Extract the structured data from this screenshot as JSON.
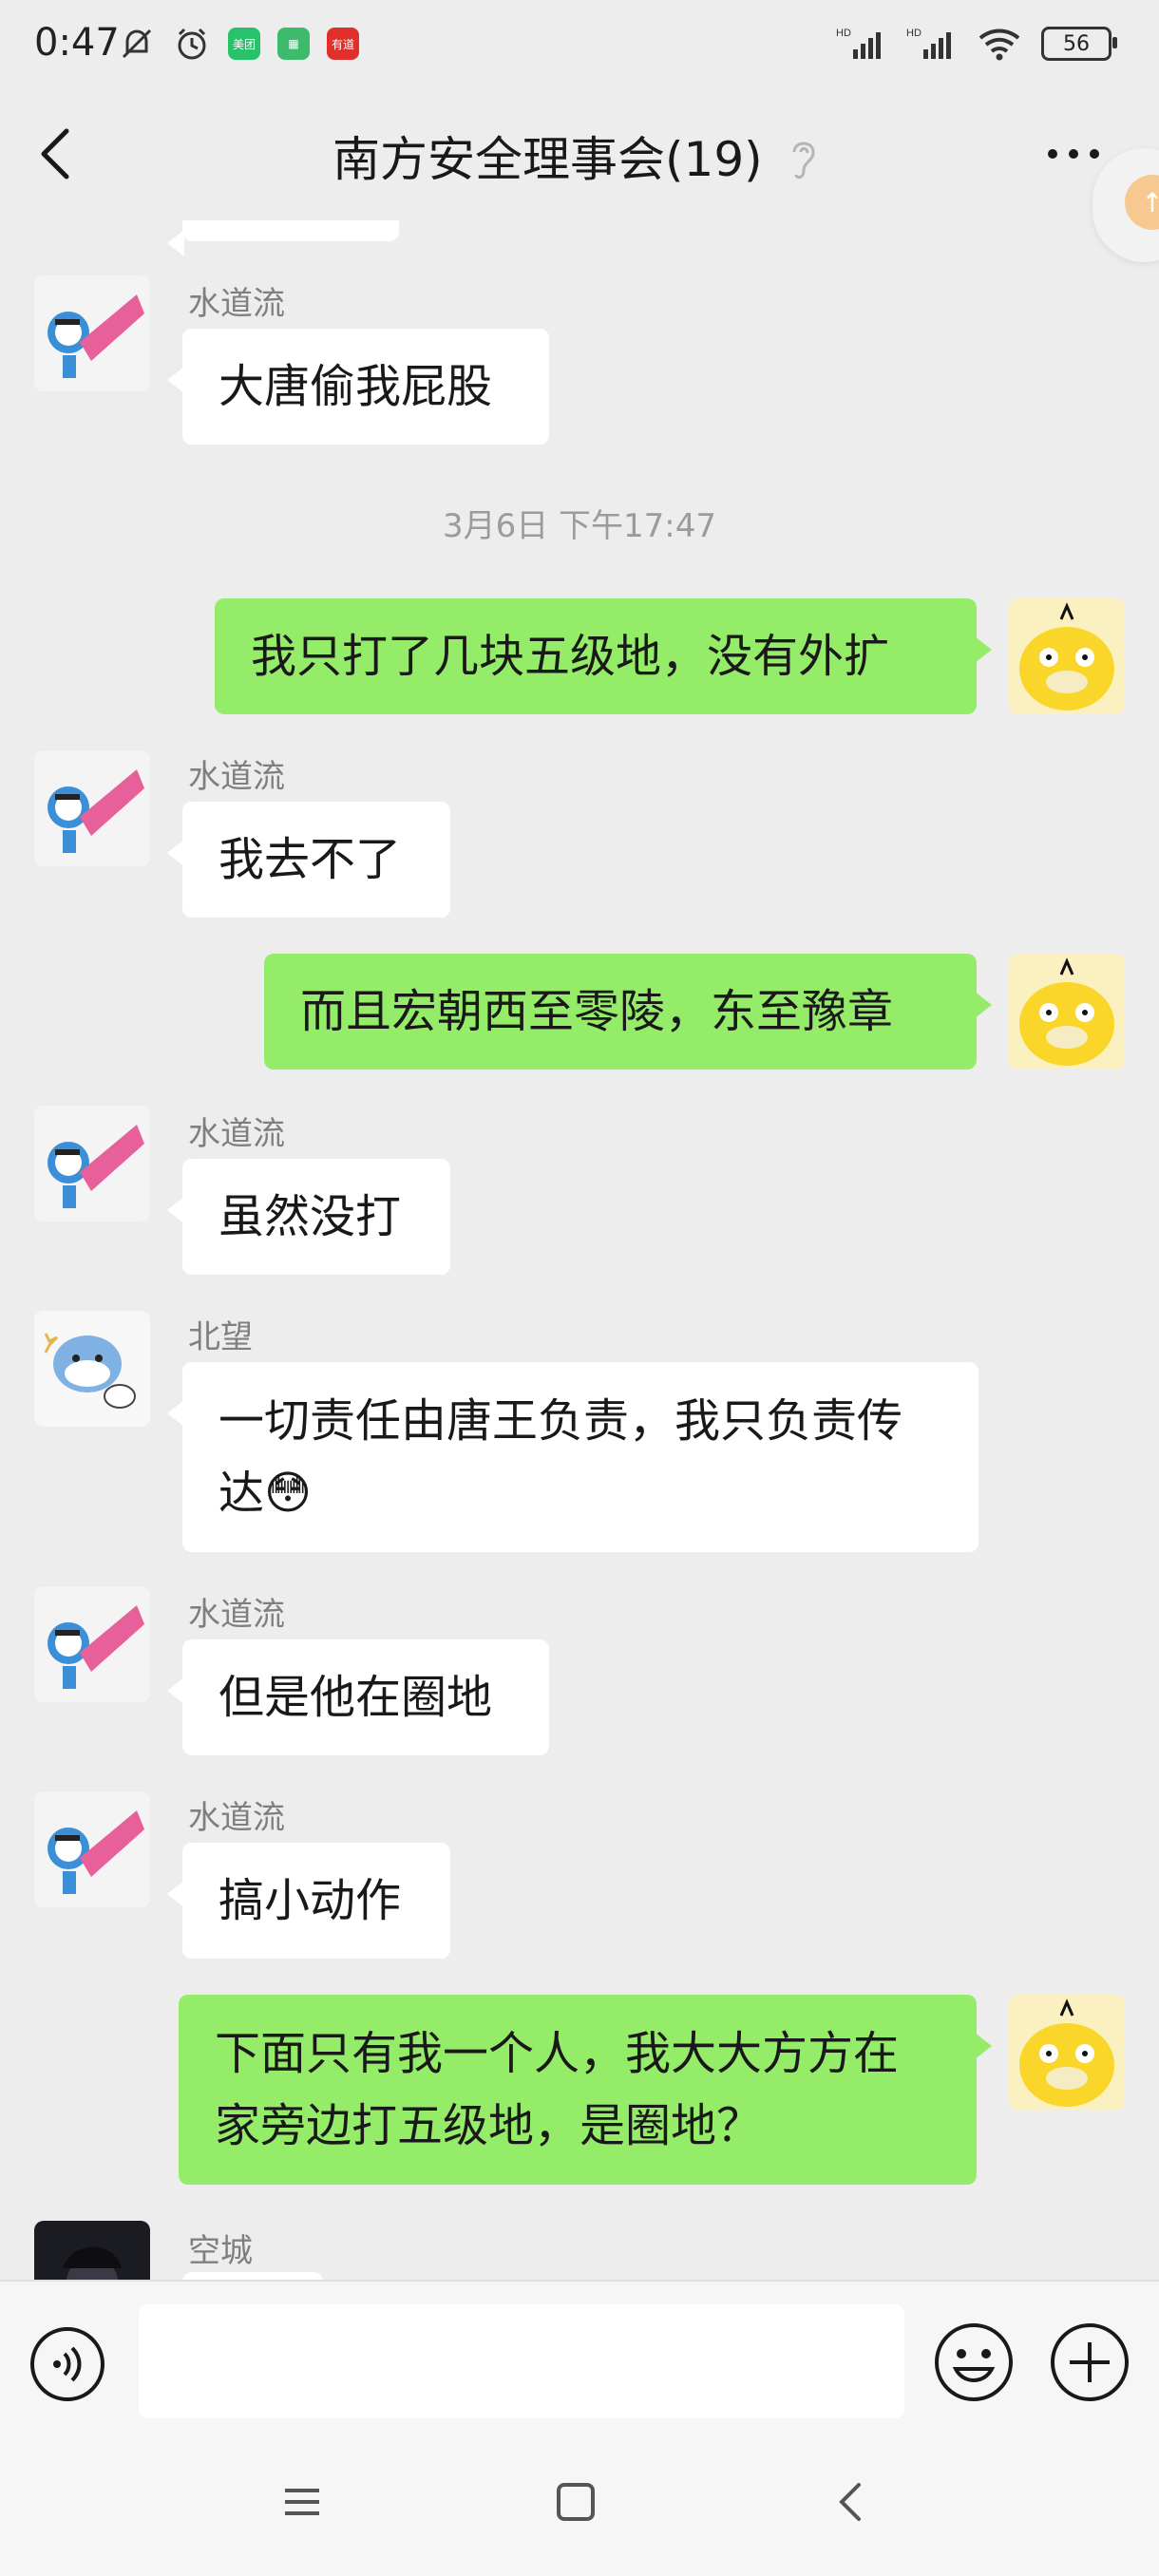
{
  "status_bar": {
    "time": "0:47",
    "app_badge_1": "美团",
    "app_badge_3": "有道",
    "battery": "56"
  },
  "header": {
    "title": "南方安全理事会(19)"
  },
  "messages": [
    {
      "type": "in",
      "sender": "水道流",
      "text": "大唐偷我屁股"
    },
    {
      "type": "time",
      "text": "3月6日 下午17:47"
    },
    {
      "type": "out",
      "text": "我只打了几块五级地，没有外扩"
    },
    {
      "type": "in",
      "sender": "水道流",
      "text": "我去不了"
    },
    {
      "type": "out",
      "text": "而且宏朝西至零陵，东至豫章"
    },
    {
      "type": "in",
      "sender": "水道流",
      "text": "虽然没打"
    },
    {
      "type": "in",
      "sender": "北望",
      "text": "一切责任由唐王负责，我只负责传",
      "text2": "达😳"
    },
    {
      "type": "in",
      "sender": "水道流",
      "text": "但是他在圈地"
    },
    {
      "type": "in",
      "sender": "水道流",
      "text": "搞小动作"
    },
    {
      "type": "out",
      "text": "下面只有我一个人，我大大方方在",
      "text2": "家旁边打五级地，是圈地？"
    },
    {
      "type": "in",
      "sender": "空城",
      "text": ""
    }
  ],
  "input": {
    "placeholder": ""
  },
  "colors": {
    "background": "#ededed",
    "outgoing_bubble": "#95ec69",
    "incoming_bubble": "#ffffff"
  },
  "icons": [
    "back-icon",
    "ear-icon",
    "more-icon",
    "voice-icon",
    "emoji-icon",
    "plus-icon",
    "nav-menu-icon",
    "nav-home-icon",
    "nav-back-icon"
  ]
}
